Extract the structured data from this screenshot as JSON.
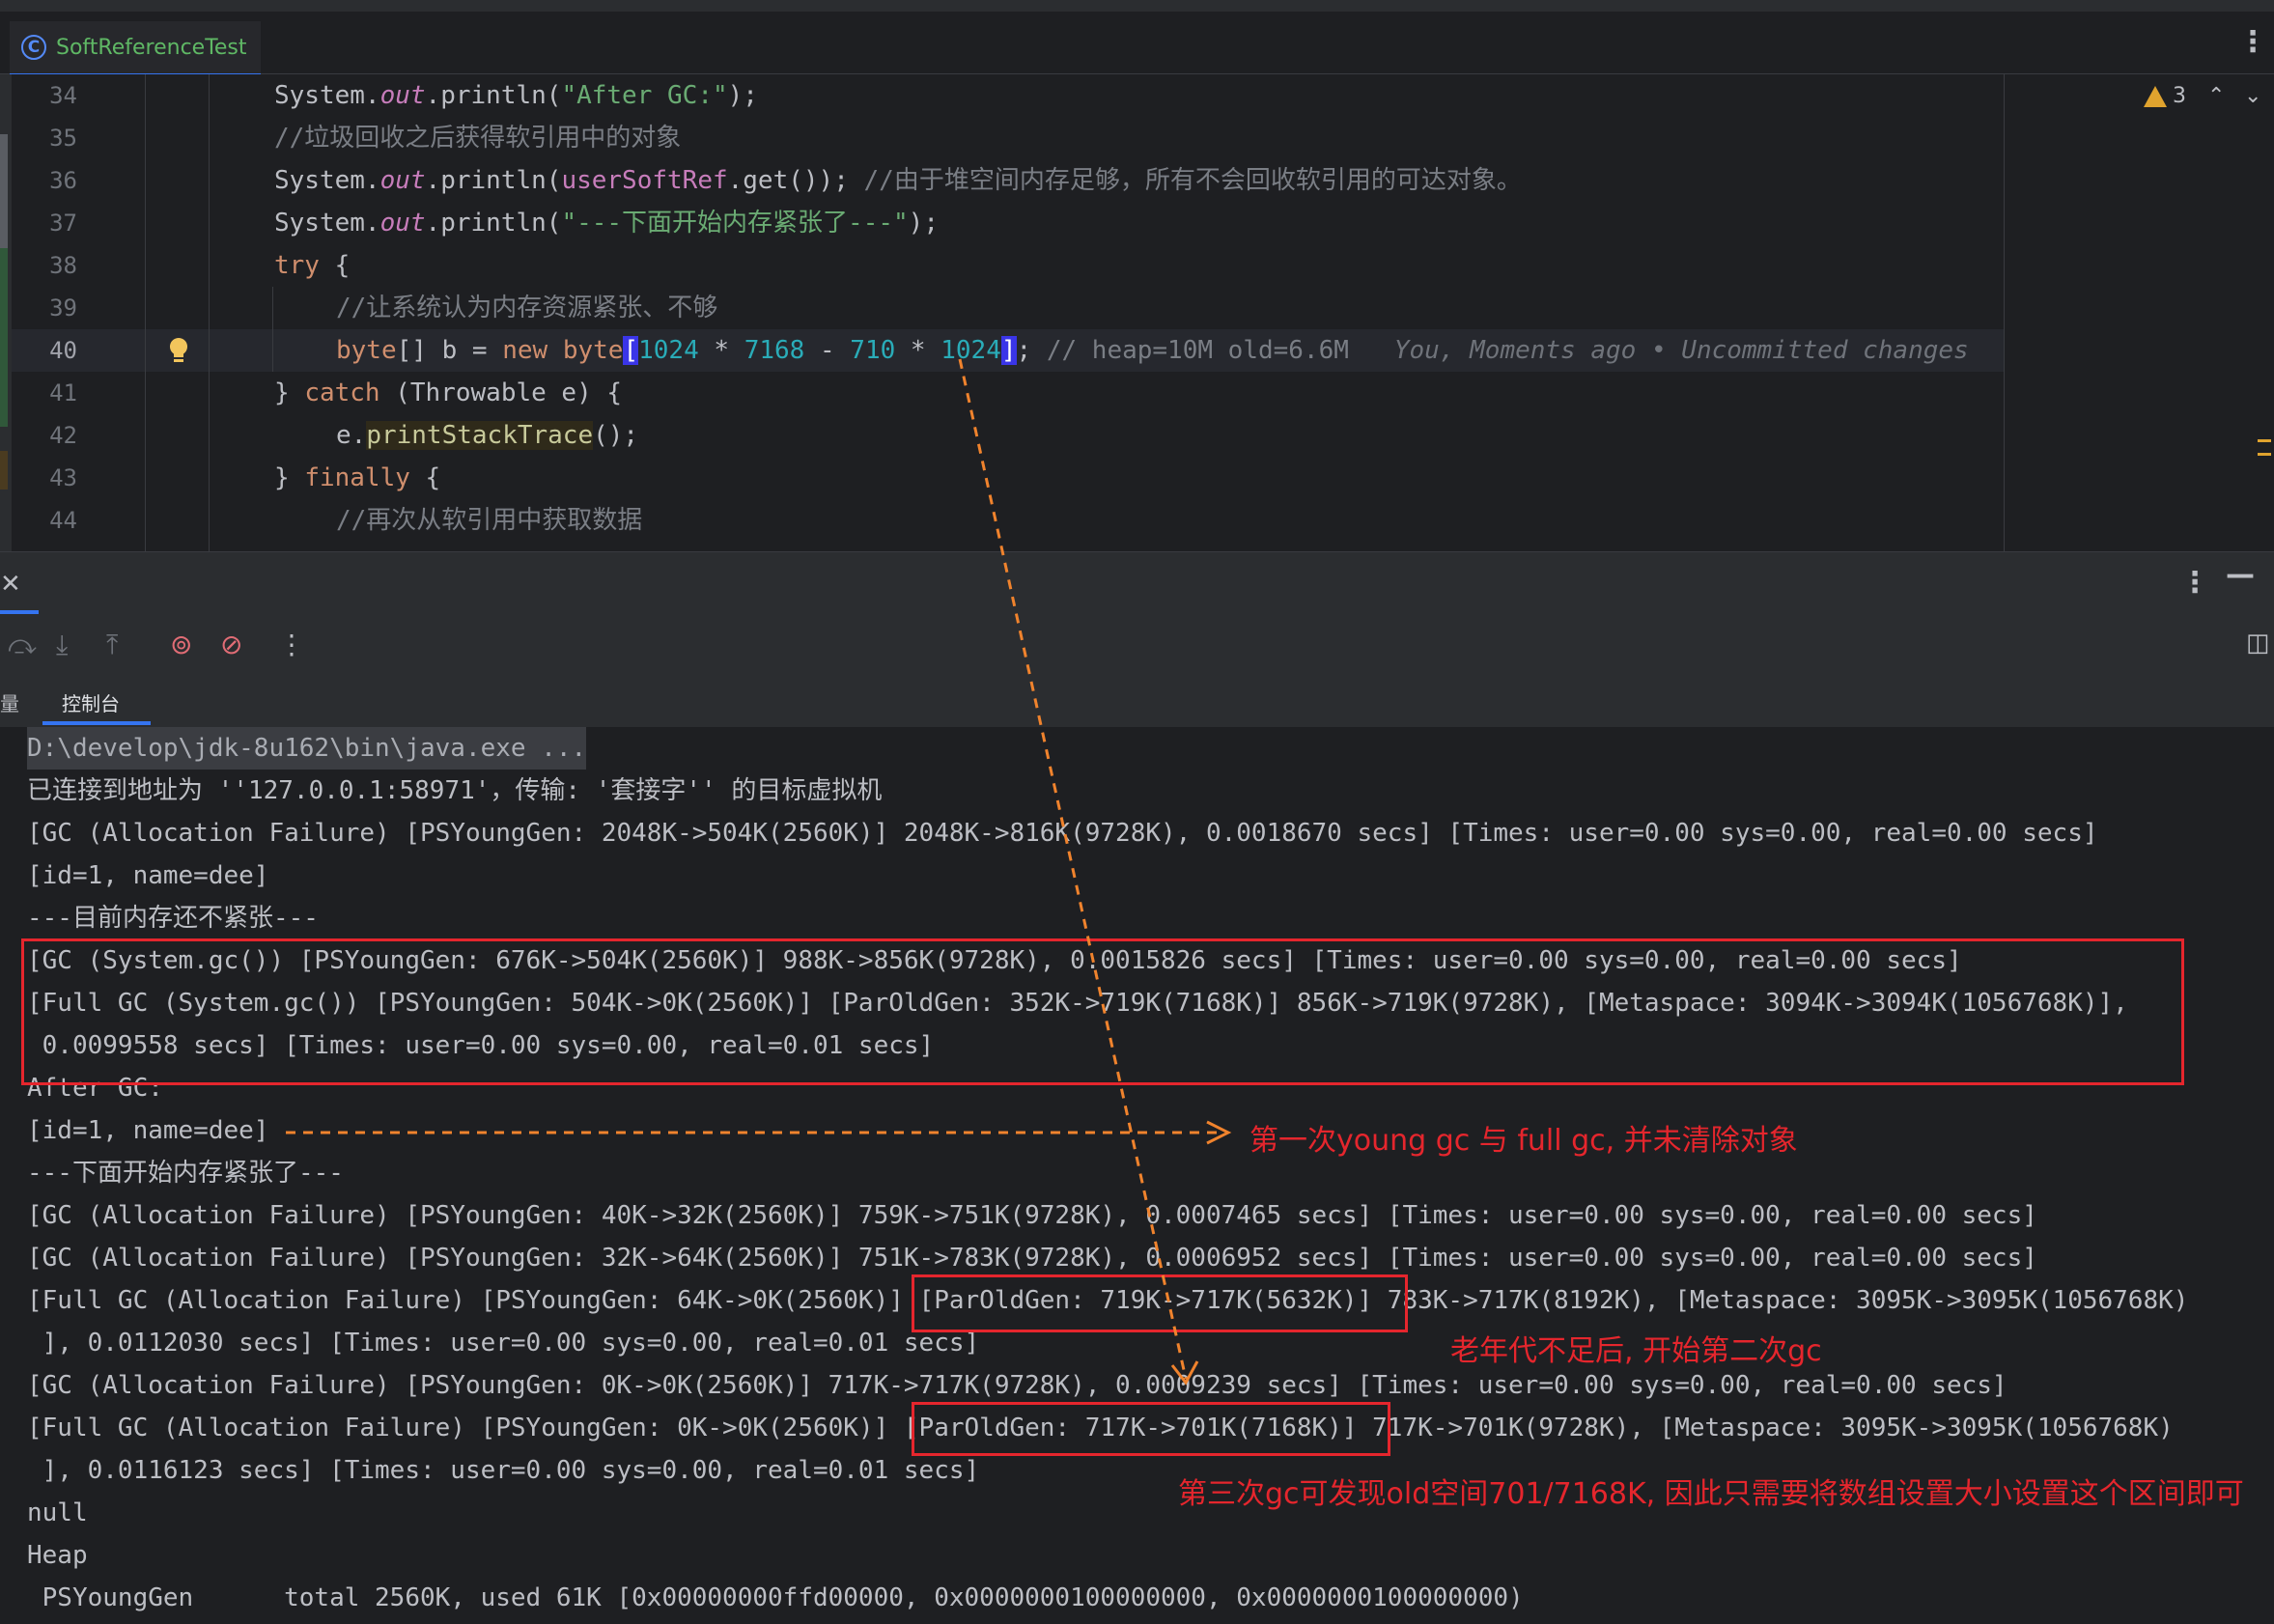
{
  "editor_tab": {
    "label": "SoftReferenceTest",
    "icon": "class-icon"
  },
  "editor": {
    "line_numbers": [
      "34",
      "35",
      "36",
      "37",
      "38",
      "39",
      "40",
      "41",
      "42",
      "43",
      "44"
    ],
    "warnings_count": "3",
    "inlay_blame": "You, Moments ago • Uncommitted changes",
    "lines": {
      "l34": [
        "System.",
        "out",
        ".println(",
        "\"After GC:\"",
        ");"
      ],
      "l35": "//垃圾回收之后获得软引用中的对象",
      "l36": [
        "System.",
        "out",
        ".println(",
        "userSoftRef",
        ".get());",
        " //由于堆空间内存足够，所有不会回收软引用的可达对象。"
      ],
      "l37": [
        "System.",
        "out",
        ".println(",
        "\"---下面开始内存紧张了---\"",
        ");"
      ],
      "l38": [
        "try",
        " {"
      ],
      "l39": "//让系统认为内存资源紧张、不够",
      "l40": [
        "byte",
        "[] b = ",
        "new",
        " ",
        "byte",
        "[",
        "1024",
        " * ",
        "7168",
        " - ",
        "710",
        " * ",
        "1024",
        "]",
        ";",
        " // heap=10M old=6.6M"
      ],
      "l41": [
        "} ",
        "catch",
        " (Throwable e) {"
      ],
      "l42": [
        "e.",
        "printStackTrace",
        "();"
      ],
      "l43": [
        "} ",
        "finally",
        " {"
      ],
      "l44": "//再次从软引用中获取数据"
    }
  },
  "tool_window": {
    "left_tab_fragment": "量",
    "console_tab": "控制台"
  },
  "console": [
    "D:\\develop\\jdk-8u162\\bin\\java.exe ...",
    "已连接到地址为 ''127.0.0.1:58971'，传输: '套接字'' 的目标虚拟机",
    "[GC (Allocation Failure) [PSYoungGen: 2048K->504K(2560K)] 2048K->816K(9728K), 0.0018670 secs] [Times: user=0.00 sys=0.00, real=0.00 secs]",
    "[id=1, name=dee]",
    "---目前内存还不紧张---",
    "[GC (System.gc()) [PSYoungGen: 676K->504K(2560K)] 988K->856K(9728K), 0.0015826 secs] [Times: user=0.00 sys=0.00, real=0.00 secs]",
    "[Full GC (System.gc()) [PSYoungGen: 504K->0K(2560K)] [ParOldGen: 352K->719K(7168K)] 856K->719K(9728K), [Metaspace: 3094K->3094K(1056768K)],",
    " 0.0099558 secs] [Times: user=0.00 sys=0.00, real=0.01 secs]",
    "After GC:",
    "[id=1, name=dee]",
    "---下面开始内存紧张了---",
    "[GC (Allocation Failure) [PSYoungGen: 40K->32K(2560K)] 759K->751K(9728K), 0.0007465 secs] [Times: user=0.00 sys=0.00, real=0.00 secs]",
    "[GC (Allocation Failure) [PSYoungGen: 32K->64K(2560K)] 751K->783K(9728K), 0.0006952 secs] [Times: user=0.00 sys=0.00, real=0.00 secs]",
    "[Full GC (Allocation Failure) [PSYoungGen: 64K->0K(2560K)] [ParOldGen: 719K->717K(5632K)] 783K->717K(8192K), [Metaspace: 3095K->3095K(1056768K)",
    " ], 0.0112030 secs] [Times: user=0.00 sys=0.00, real=0.01 secs]",
    "[GC (Allocation Failure) [PSYoungGen: 0K->0K(2560K)] 717K->717K(9728K), 0.0009239 secs] [Times: user=0.00 sys=0.00, real=0.00 secs]",
    "[Full GC (Allocation Failure) [PSYoungGen: 0K->0K(2560K)] [ParOldGen: 717K->701K(7168K)] 717K->701K(9728K), [Metaspace: 3095K->3095K(1056768K)",
    " ], 0.0116123 secs] [Times: user=0.00 sys=0.00, real=0.01 secs]",
    "null",
    "Heap",
    " PSYoungGen      total 2560K, used 61K [0x00000000ffd00000, 0x0000000100000000, 0x0000000100000000)"
  ],
  "annotations": {
    "note1": "第一次young gc 与 full gc, 并未清除对象",
    "note2": "老年代不足后, 开始第二次gc",
    "note3": "第三次gc可发现old空间701/7168K, 因此只需要将数组设置大小设置这个区间即可"
  },
  "colors": {
    "accent": "#3574f0",
    "annotation_red": "#e5262d",
    "arrow_orange": "#f0832d",
    "warning": "#e0a32e"
  }
}
